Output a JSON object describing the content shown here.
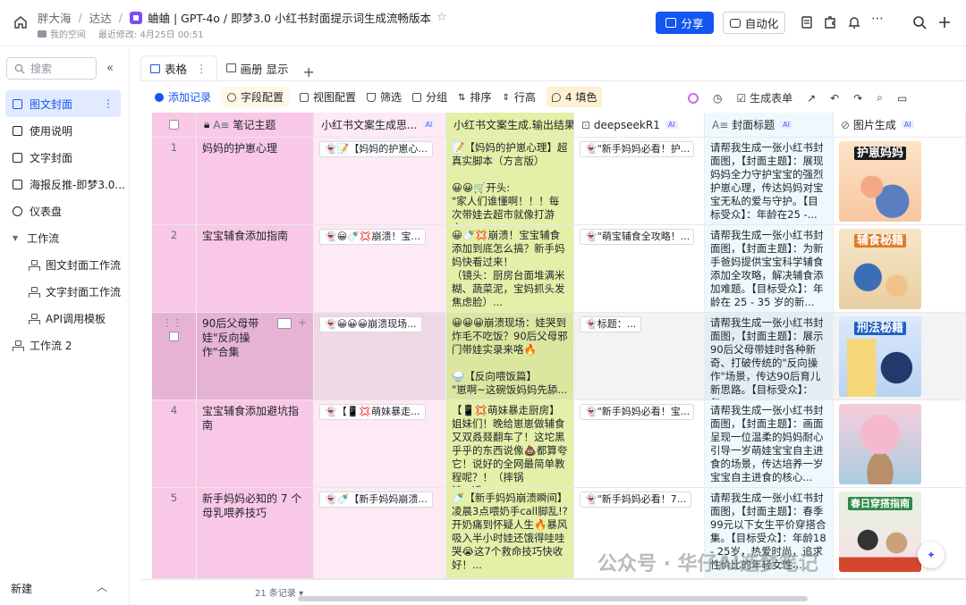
{
  "breadcrumb": {
    "owner": "胖大海",
    "space": "达达",
    "title": "蛐蛐 | GPT-4o / 即梦3.0 小红书封面提示词生成流畅版本"
  },
  "meta": {
    "location": "我的空间",
    "edited": "最近修改: 4月25日 00:51"
  },
  "topbar": {
    "share_label": "分享",
    "automate_label": "自动化"
  },
  "sidebar": {
    "search_placeholder": "搜索",
    "items": [
      {
        "label": "图文封面"
      },
      {
        "label": "使用说明"
      },
      {
        "label": "文字封面"
      },
      {
        "label": "海报反推-即梦3.0..."
      },
      {
        "label": "仪表盘"
      },
      {
        "label": "工作流"
      },
      {
        "label": "图文封面工作流"
      },
      {
        "label": "文字封面工作流"
      },
      {
        "label": "API调用模板"
      },
      {
        "label": "工作流 2"
      }
    ],
    "new_label": "新建"
  },
  "tabs": [
    {
      "label": "表格"
    },
    {
      "label": "画册 显示"
    }
  ],
  "toolbar": {
    "add": "添加记录",
    "fields": "字段配置",
    "view": "视图配置",
    "filter": "筛选",
    "group": "分组",
    "sort": "排序",
    "rowheight": "行高",
    "fill": "4 填色",
    "form": "生成表单"
  },
  "columns": {
    "topic": "笔记主题",
    "think": "小红书文案生成思...",
    "output": "小红书文案生成.输出结果",
    "deep": "deepseekR1",
    "cover": "封面标题",
    "image": "图片生成",
    "ai": "AI"
  },
  "rows": [
    {
      "idx": "1",
      "topic": "妈妈的护崽心理",
      "think": "👻📝【妈妈的护崽心...",
      "output": "📝【妈妈的护崽心理】超真实脚本（方言版）\n\n😀😀🛒开头:\n\"家人们谁懂啊！！！每次带娃去超市就像打游击...",
      "deep": "👻\"新手妈妈必看！护...",
      "cover": "请帮我生成一张小红书封面图，【封面主题】：展现妈妈全力守护宝宝的强烈护崽心理，传达妈妈对宝宝无私的爱与守护。【目标受众】：年龄在25 -...",
      "img_title": "护崽妈妈"
    },
    {
      "idx": "2",
      "topic": "宝宝辅食添加指南",
      "think": "👻😀🍼💢崩溃！宝...",
      "output": "😀🍼💢崩溃！宝宝辅食添加到底怎么搞？新手妈妈快看过来！\n（镜头：厨房台面堆满米糊、蔬菜泥，宝妈抓头发焦虑脸）...",
      "deep": "👻\"萌宝辅食全攻略！...",
      "cover": "请帮我生成一张小红书封面图，【封面主题】：为新手爸妈提供宝宝科学辅食添加全攻略，解决辅食添加难题。【目标受众】：年龄在 25 - 35 岁的新...",
      "img_title": "辅食秘籍"
    },
    {
      "idx": "",
      "topic": "90后父母带娃\"反向操作\"合集",
      "think": "👻😀😀😀崩溃现场...",
      "output": "😀😀😀崩溃现场：娃哭到炸毛不吃饭？90后父母邪门带娃实录来咯🔥\n\n🍚【反向喂饭篇】\n\"崽啊~这碗饭妈妈先舔...",
      "deep": "👻标题：...",
      "cover": "请帮我生成一张小红书封面图，【封面主题】：展示90后父母带娃时各种新奇、打破传统的\"反向操作\"场景，传达90后育儿新思路。【目标受众】：年...",
      "img_title": "刑法秘籍"
    },
    {
      "idx": "4",
      "topic": "宝宝辅食添加避坑指南",
      "think": "👻【📱💢萌妹暴走...",
      "output": "【📱💢萌妹暴走厨房】姐妹们！晚给崽崽做辅食又双叒叕翻车了！这坨黑乎乎的东西说像💩都算夸它！说好的全网最简单教程呢？！（摔锅铲.gif）...",
      "deep": "👻\"新手妈妈必看！宝...",
      "cover": "请帮我生成一张小红书封面图，【封面主题】：画面呈现一位温柔的妈妈耐心引导一岁萌娃宝宝自主进食的场景，传达培养一岁宝宝自主进食的核心...",
      "img_title": ""
    },
    {
      "idx": "5",
      "topic": "新手妈妈必知的 7 个母乳喂养技巧",
      "think": "👻🍼【新手妈妈崩溃...",
      "output": "🍼【新手妈妈崩溃瞬间】凌晨3点喂奶手call脚乱!?开奶痛到怀疑人生🔥暴风吸入半小时娃还饿得哇哇哭😭这7个救命技巧快收好！...",
      "deep": "👻\"新手妈妈必看！7...",
      "cover": "请帮我生成一张小红书封面图，【封面主题】：春季99元以下女生平价穿搭合集。【目标受众】：年龄18 - 25岁，热爱时尚，追求性价比的年轻女性...",
      "img_title": "春日穿搭指南"
    }
  ],
  "footer": {
    "count": "21 条记录"
  },
  "watermark": "公众号 · 华仔AI造梦笔记",
  "colors": {
    "accent": "#1456f0",
    "topic_col": "#f9c8e6",
    "output_col": "#e4f0a8",
    "cover_col": "#eef9fd"
  }
}
